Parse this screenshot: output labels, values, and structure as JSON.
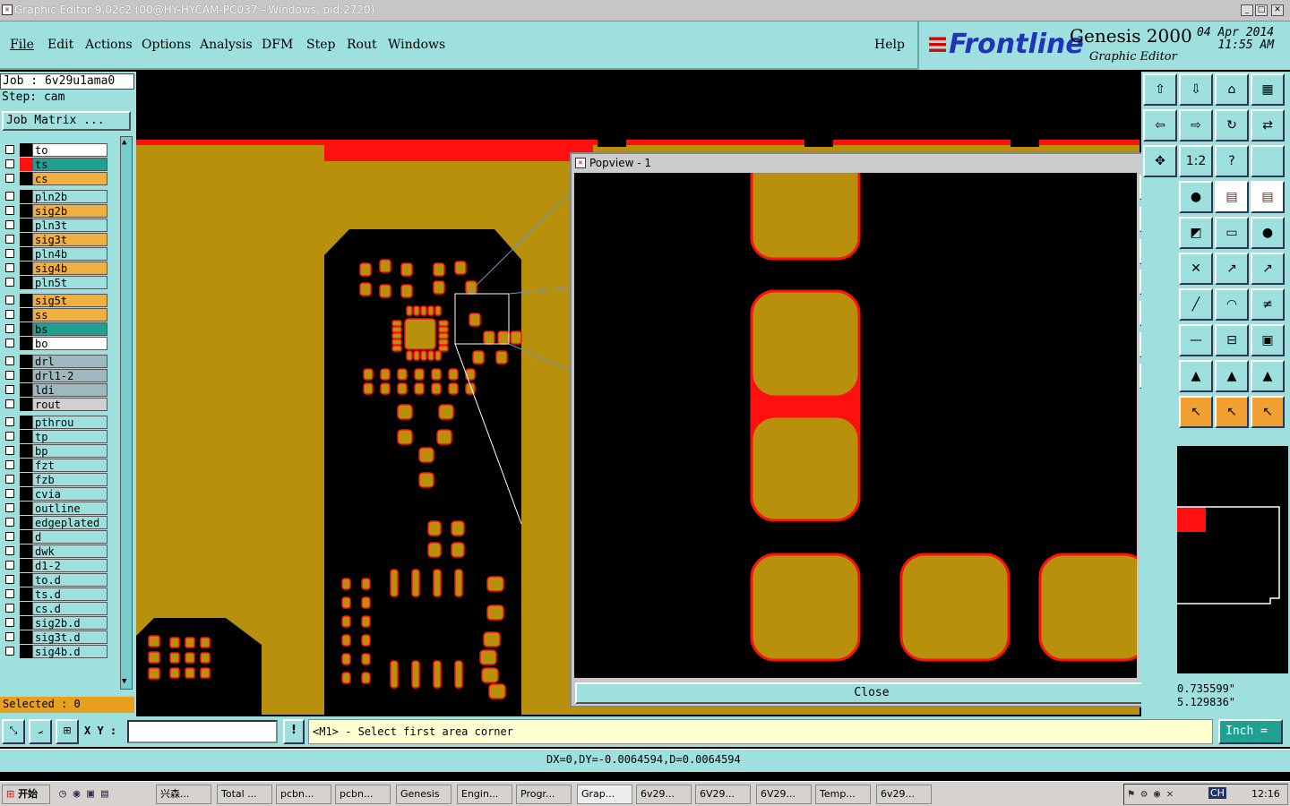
{
  "window": {
    "title": "Graphic Editor 9.02c2 (00@HY-HYCAM-PC037 - Windows, pid:2720)"
  },
  "menu": {
    "items": [
      "File",
      "Edit",
      "Actions",
      "Options",
      "Analysis",
      "DFM",
      "Step",
      "Rout",
      "Windows"
    ],
    "help": "Help"
  },
  "brand": {
    "logo": "Frontline",
    "product": "Genesis 2000",
    "module": "Graphic Editor",
    "date": "04 Apr 2014",
    "time": "11:55 AM"
  },
  "job": {
    "job_label": "Job : 6v29u1ama0",
    "step_label": "Step: cam",
    "matrix_button": "Job Matrix ..."
  },
  "layers": [
    {
      "name": "to",
      "color": "#ffffff"
    },
    {
      "name": "ts",
      "color": "#20a090",
      "active": true
    },
    {
      "name": "cs",
      "color": "#f0b040"
    },
    {
      "name": "pln2b",
      "color": "#9ee0de"
    },
    {
      "name": "sig2b",
      "color": "#f0b040"
    },
    {
      "name": "pln3t",
      "color": "#9ee0de"
    },
    {
      "name": "sig3t",
      "color": "#f0b040"
    },
    {
      "name": "pln4b",
      "color": "#9ee0de"
    },
    {
      "name": "sig4b",
      "color": "#f0b040"
    },
    {
      "name": "pln5t",
      "color": "#9ee0de"
    },
    {
      "name": "sig5t",
      "color": "#f0b040"
    },
    {
      "name": "ss",
      "color": "#f0b040"
    },
    {
      "name": "bs",
      "color": "#20a090"
    },
    {
      "name": "bo",
      "color": "#ffffff"
    },
    {
      "name": "drl",
      "color": "#9eb8c0"
    },
    {
      "name": "drl1-2",
      "color": "#9eb8c0"
    },
    {
      "name": "ldi",
      "color": "#9eb8c0"
    },
    {
      "name": "rout",
      "color": "#d0d0d0"
    },
    {
      "name": "pthrou",
      "color": "#9ee0de"
    },
    {
      "name": "tp",
      "color": "#9ee0de"
    },
    {
      "name": "bp",
      "color": "#9ee0de"
    },
    {
      "name": "fzt",
      "color": "#9ee0de"
    },
    {
      "name": "fzb",
      "color": "#9ee0de"
    },
    {
      "name": "cvia",
      "color": "#9ee0de"
    },
    {
      "name": "outline",
      "color": "#9ee0de"
    },
    {
      "name": "edgeplated",
      "color": "#9ee0de"
    },
    {
      "name": "d",
      "color": "#9ee0de"
    },
    {
      "name": "dwk",
      "color": "#9ee0de"
    },
    {
      "name": "d1-2",
      "color": "#9ee0de"
    },
    {
      "name": "to.d",
      "color": "#9ee0de"
    },
    {
      "name": "ts.d",
      "color": "#9ee0de"
    },
    {
      "name": "cs.d",
      "color": "#9ee0de"
    },
    {
      "name": "sig2b.d",
      "color": "#9ee0de"
    },
    {
      "name": "sig3t.d",
      "color": "#9ee0de"
    },
    {
      "name": "sig4b.d",
      "color": "#9ee0de"
    }
  ],
  "selected": "Selected : 0",
  "popview": {
    "title": "Popview - 1",
    "close": "Close"
  },
  "coords": {
    "x": "0.735599\"",
    "y": "5.129836\""
  },
  "statusbar": {
    "xy_label": "X Y :",
    "xy_value": "",
    "prompt": "<M1> - Select first area corner",
    "units": "Inch",
    "delta": "DX=0,DY=-0.0064594,D=0.0064594"
  },
  "taskbar": {
    "start": "开始",
    "items": [
      "兴森...",
      "Total ...",
      "pcbn...",
      "pcbn...",
      "Genesis",
      "Engin...",
      "Progr...",
      "Grap...",
      "6v29...",
      "6V29...",
      "6V29...",
      "Temp...",
      "6v29..."
    ],
    "tray_lang": "CH",
    "clock": "12:16"
  },
  "colors": {
    "copper": "#b8900c",
    "mask": "#ff1010",
    "panel": "#9ee0de"
  }
}
